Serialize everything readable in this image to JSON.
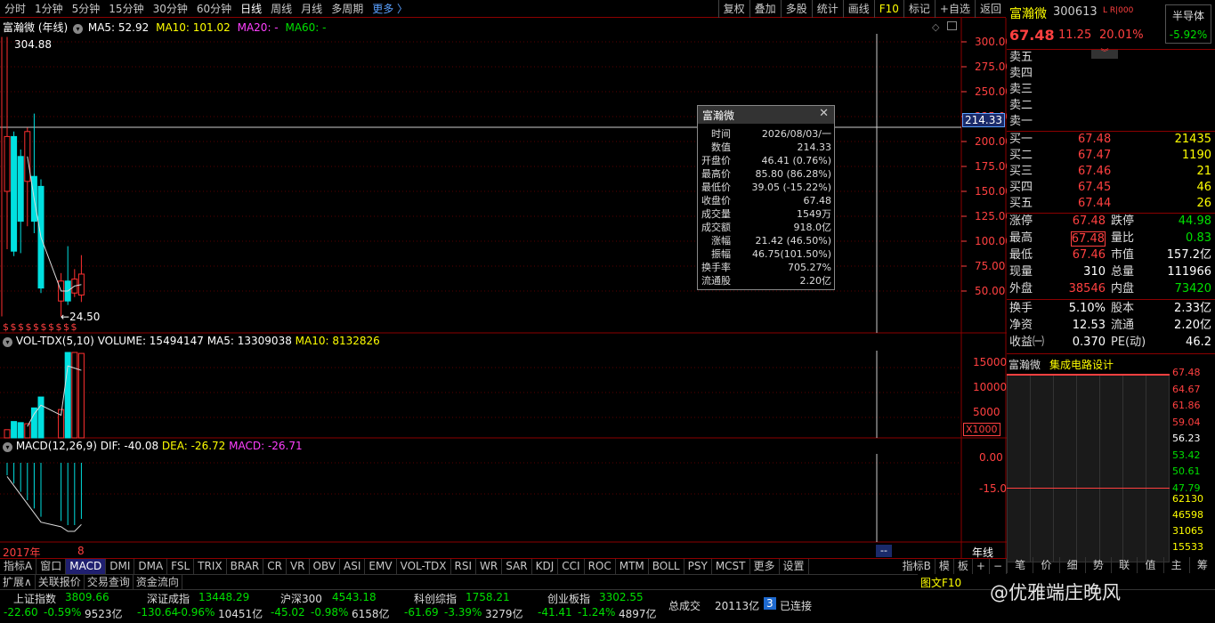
{
  "toolbar": {
    "periods": [
      "分时",
      "1分钟",
      "5分钟",
      "15分钟",
      "30分钟",
      "60分钟",
      "日线",
      "周线",
      "月线",
      "多周期"
    ],
    "more": "更多 〉",
    "right": [
      "复权",
      "叠加",
      "多股",
      "统计",
      "画线",
      "F10",
      "标记",
      "+自选",
      "返回"
    ]
  },
  "main_header": {
    "name": "富瀚微 (年线)",
    "ma5": "MA5: 52.92",
    "ma10": "MA10: 101.02",
    "ma20": "MA20: -",
    "ma60": "MA60: -"
  },
  "price_axis": [
    "300.00",
    "275.00",
    "250.00",
    "225.00",
    "200.00",
    "175.00",
    "150.00",
    "125.00",
    "100.00",
    "75.00",
    "50.00"
  ],
  "cursor_price": "214.33",
  "annot_high": "304.88",
  "annot_low": "←24.50",
  "dollar_marks": "$ $ $ $ $ $ $ $ $ $",
  "vol_header": {
    "name": "VOL-TDX(5,10)",
    "volume": "VOLUME: 15494147",
    "ma5": "MA5: 13309038",
    "ma10": "MA10: 8132826"
  },
  "vol_axis": [
    "15000",
    "10000",
    "5000"
  ],
  "vol_unit": "X1000",
  "macd_header": {
    "name": "MACD(12,26,9)",
    "dif": "DIF: -40.08",
    "dea": "DEA: -26.72",
    "macd": "MACD: -26.71"
  },
  "macd_axis": [
    "0.00",
    "-15.00"
  ],
  "date_start": "2017年",
  "date_marker": "8",
  "date_cursor": "--",
  "period_label": "年线",
  "tooltip": {
    "title": "富瀚微",
    "rows": [
      {
        "k": "时间",
        "v": "2026/08/03/一",
        "c": "w"
      },
      {
        "k": "数值",
        "v": "214.33",
        "c": "w"
      },
      {
        "k": "开盘价",
        "v": "46.41 (0.76%)",
        "c": "r"
      },
      {
        "k": "最高价",
        "v": "85.80 (86.28%)",
        "c": "r"
      },
      {
        "k": "最低价",
        "v": "39.05 (-15.22%)",
        "c": "g"
      },
      {
        "k": "收盘价",
        "v": "67.48",
        "c": "r"
      },
      {
        "k": "成交量",
        "v": "1549万",
        "c": "w"
      },
      {
        "k": "成交额",
        "v": "918.0亿",
        "c": "w"
      },
      {
        "k": "涨幅",
        "v": "21.42 (46.50%)",
        "c": "r"
      },
      {
        "k": "振幅",
        "v": "46.75(101.50%)",
        "c": "w"
      },
      {
        "k": "换手率",
        "v": "705.27%",
        "c": "w"
      },
      {
        "k": "流通股",
        "v": "2.20亿",
        "c": "w"
      }
    ]
  },
  "stock": {
    "name": "富瀚微",
    "code": "300613",
    "flags": "L R|000",
    "price": "67.48",
    "change": "11.25",
    "pct": "20.01%",
    "sector": "半导体",
    "sector_pct": "-5.92%"
  },
  "sells": [
    "卖五",
    "卖四",
    "卖三",
    "卖二",
    "卖一"
  ],
  "buys": [
    {
      "label": "买一",
      "price": "67.48",
      "vol": "21435"
    },
    {
      "label": "买二",
      "price": "67.47",
      "vol": "1190"
    },
    {
      "label": "买三",
      "price": "67.46",
      "vol": "21"
    },
    {
      "label": "买四",
      "price": "67.45",
      "vol": "46"
    },
    {
      "label": "买五",
      "price": "67.44",
      "vol": "26"
    }
  ],
  "quote": [
    {
      "l1": "涨停",
      "v1": "67.48",
      "c1": "r",
      "l2": "跌停",
      "v2": "44.98",
      "c2": "g"
    },
    {
      "l1": "最高",
      "v1": "67.48",
      "c1": "r",
      "l2": "量比",
      "v2": "0.83",
      "c2": "g"
    },
    {
      "l1": "最低",
      "v1": "67.46",
      "c1": "r",
      "l2": "市值",
      "v2": "157.2亿",
      "c2": "w"
    },
    {
      "l1": "现量",
      "v1": "310",
      "c1": "w",
      "l2": "总量",
      "v2": "111966",
      "c2": "w"
    },
    {
      "l1": "外盘",
      "v1": "38546",
      "c1": "r",
      "l2": "内盘",
      "v2": "73420",
      "c2": "g"
    }
  ],
  "fund": [
    {
      "l1": "换手",
      "v1": "5.10%",
      "l2": "股本",
      "v2": "2.33亿"
    },
    {
      "l1": "净资",
      "v1": "12.53",
      "l2": "流通",
      "v2": "2.20亿"
    },
    {
      "l1": "收益㈠",
      "v1": "0.370",
      "l2": "PE(动)",
      "v2": "46.2"
    }
  ],
  "mini": {
    "name": "富瀚微",
    "industry": "集成电路设计",
    "axis": [
      "67.48",
      "64.67",
      "61.86",
      "59.04",
      "56.23",
      "53.42",
      "50.61",
      "47.79"
    ],
    "vol_axis": [
      "62130",
      "46598",
      "31065",
      "15533"
    ]
  },
  "tabs": [
    "指标A",
    "窗口",
    "MACD",
    "DMI",
    "DMA",
    "FSL",
    "TRIX",
    "BRAR",
    "CR",
    "VR",
    "OBV",
    "ASI",
    "EMV",
    "VOL-TDX",
    "RSI",
    "WR",
    "SAR",
    "KDJ",
    "CCI",
    "ROC",
    "MTM",
    "BOLL",
    "PSY",
    "MCST",
    "更多",
    "设置"
  ],
  "tabs2": [
    "扩展∧",
    "关联报价",
    "交易查询",
    "资金流向"
  ],
  "tabs_right": [
    "指标B",
    "模",
    "板",
    "+",
    "−"
  ],
  "right_tabs": [
    "笔",
    "价",
    "细",
    "势",
    "联",
    "值",
    "主",
    "筹"
  ],
  "right_bottom": "图文F10",
  "indices": [
    {
      "name": "上证指数",
      "val": "3809.66",
      "chg": "-22.60",
      "pct": "-0.59%",
      "amt": "9523亿"
    },
    {
      "name": "深证成指",
      "val": "13448.29",
      "chg": "-130.64",
      "pct": "-0.96%",
      "amt": "10451亿"
    },
    {
      "name": "沪深300",
      "val": "4543.18",
      "chg": "-45.02",
      "pct": "-0.98%",
      "amt": "6158亿"
    },
    {
      "name": "科创综指",
      "val": "1758.21",
      "chg": "-61.69",
      "pct": "-3.39%",
      "amt": "3279亿"
    },
    {
      "name": "创业板指",
      "val": "3302.55",
      "chg": "-41.41",
      "pct": "-1.24%",
      "amt": "4897亿"
    }
  ],
  "total_label": "总成交",
  "total_val": "20113亿",
  "conn_num": "3",
  "conn_text": "已连接",
  "watermark": "@优雅端庄晚风",
  "chart_data": {
    "type": "candlestick",
    "price_ylim": [
      24.5,
      304.88
    ],
    "candles": [
      {
        "o": 150,
        "c": 205,
        "h": 304.88,
        "l": 92
      },
      {
        "o": 205,
        "c": 90,
        "h": 210,
        "l": 85
      },
      {
        "o": 185,
        "c": 120,
        "h": 192,
        "l": 88
      },
      {
        "o": 160,
        "c": 210,
        "h": 214,
        "l": 115
      },
      {
        "o": 165,
        "c": 120,
        "h": 228,
        "l": 108
      },
      {
        "o": 155,
        "c": 53,
        "h": 162,
        "l": 48
      },
      {
        "o": 40,
        "c": 60,
        "h": 68,
        "l": 24.5
      },
      {
        "o": 60,
        "c": 40,
        "h": 95,
        "l": 36
      },
      {
        "o": 48,
        "c": 62,
        "h": 72,
        "l": 44
      },
      {
        "o": 46,
        "c": 67,
        "h": 86,
        "l": 39
      }
    ],
    "volume_ylim": [
      0,
      16000
    ],
    "volumes": [
      1500,
      3000,
      2800,
      2600,
      5500,
      7500,
      5200,
      16500,
      16000,
      15494
    ],
    "macd": [
      -6,
      -10,
      -14,
      -18,
      -22,
      -26,
      -28,
      -30,
      -30,
      -27
    ]
  }
}
